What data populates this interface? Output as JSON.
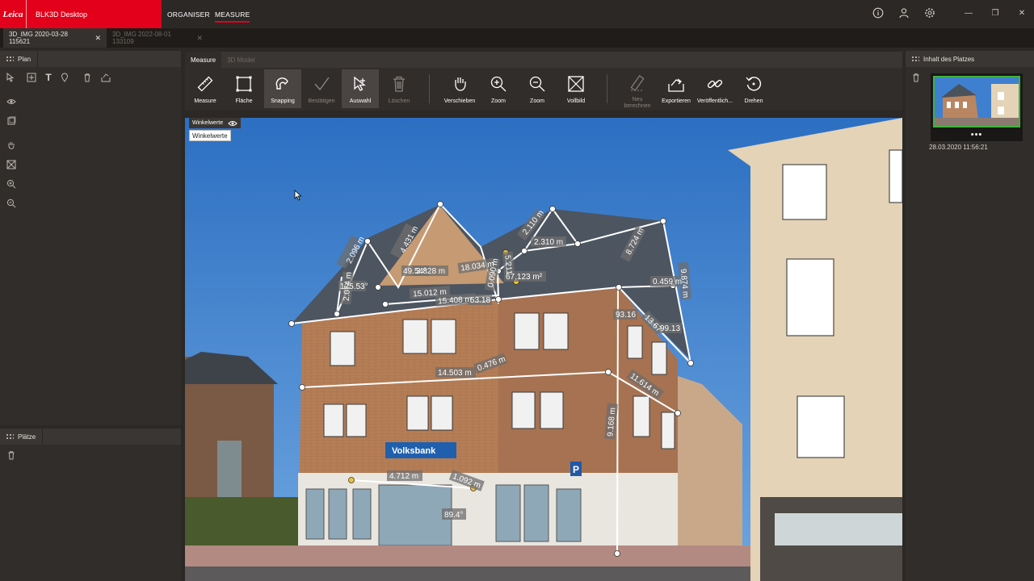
{
  "app": {
    "logo_text": "Leica",
    "name": "BLK3D Desktop"
  },
  "nav": {
    "organiser": "ORGANISER",
    "measure": "MEASURE"
  },
  "titlebar_icons": [
    "info-icon",
    "user-icon",
    "settings-icon"
  ],
  "window_controls": {
    "minimize": "—",
    "maximize": "❐",
    "close": "✕"
  },
  "tabs": [
    {
      "label": "3D_IMG 2020-03-28 115621",
      "close": "✕",
      "active": true
    },
    {
      "label": "3D_IMG 2022-08-01 133109",
      "close": "✕",
      "active": false
    }
  ],
  "left_panel": {
    "plan_title": "Plan",
    "places_title": "Plätze"
  },
  "center": {
    "tabs": [
      "Measure",
      "3D Model"
    ],
    "tools": [
      {
        "label": "Measure",
        "icon": "ruler-icon"
      },
      {
        "label": "Fläche",
        "icon": "area-icon"
      },
      {
        "label": "Snapping",
        "icon": "magnet-icon"
      },
      {
        "label": "Bestätigen",
        "icon": "check-icon"
      },
      {
        "label": "Auswahl",
        "icon": "select-cursor-icon"
      },
      {
        "label": "Löschen",
        "icon": "trash-icon"
      },
      {
        "label": "Verschieben",
        "icon": "hand-icon"
      },
      {
        "label": "Zoom",
        "icon": "zoom-in-icon"
      },
      {
        "label": "Zoom",
        "icon": "zoom-out-icon"
      },
      {
        "label": "Vollbild",
        "icon": "fullscreen-icon"
      },
      {
        "label": "Neu berechnen",
        "icon": "recalculate-icon"
      },
      {
        "label": "Exportieren",
        "icon": "export-icon"
      },
      {
        "label": "Veröffentlich...",
        "icon": "link-icon"
      },
      {
        "label": "Drehen",
        "icon": "rotate-icon"
      }
    ],
    "angle_toggle": "Winkelwerte",
    "angle_tooltip": "Winkelwerte"
  },
  "measurements": [
    "2.096 m",
    "4.431 m",
    "2.110 m",
    "2.310 m",
    "8.724 m",
    "9.874 m",
    "0.459 m",
    "125.53°",
    "49.54°",
    "3.828 m",
    "18.034 m",
    "67.123 m²",
    "5.211",
    "2.074 m",
    "15.012 m",
    "15.408 m",
    "53.18",
    "0.090 m",
    "93.16",
    "13.67",
    "99.13",
    "14.503 m",
    "0.476 m",
    "11.614 m",
    "9.168 m",
    "4.712 m",
    "1.092 m",
    "89.4°"
  ],
  "scene_signs": {
    "bank": "Volksbank",
    "parking": "P"
  },
  "right_panel": {
    "title": "Inhalt des Platzes",
    "thumb_dots": "•••",
    "thumb_date": "28.03.2020 11:56:21"
  },
  "colors": {
    "brand_red": "#e2001a",
    "panel": "#312d2a",
    "selection_green": "#3cb43c"
  }
}
